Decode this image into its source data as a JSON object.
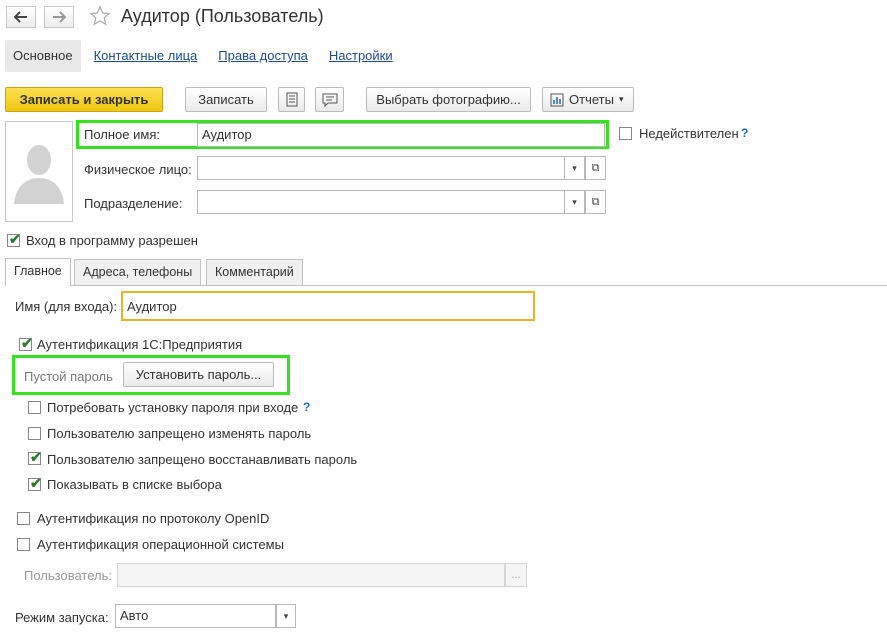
{
  "window": {
    "title": "Аудитор (Пользователь)"
  },
  "nav": {
    "tabs": [
      "Основное",
      "Контактные лица",
      "Права доступа",
      "Настройки"
    ]
  },
  "toolbar": {
    "save_close": "Записать и закрыть",
    "save": "Записать",
    "choose_photo": "Выбрать фотографию...",
    "reports": "Отчеты"
  },
  "form": {
    "full_name_label": "Полное имя:",
    "full_name_value": "Аудитор",
    "inactive_label": "Недействителен",
    "person_label": "Физическое лицо:",
    "person_value": "",
    "department_label": "Подразделение:",
    "department_value": "",
    "login_allowed_label": "Вход в программу разрешен"
  },
  "inner_tabs": [
    "Главное",
    "Адреса, телефоны",
    "Комментарий"
  ],
  "main_tab": {
    "login_name_label": "Имя (для входа):",
    "login_name_value": "Аудитор",
    "auth_1c_label": "Аутентификация 1С:Предприятия",
    "empty_password_label": "Пустой пароль",
    "set_password_button": "Установить пароль...",
    "options": [
      {
        "label": "Потребовать установку пароля при входе",
        "checked": false,
        "help": true
      },
      {
        "label": "Пользователю запрещено изменять пароль",
        "checked": false
      },
      {
        "label": "Пользователю запрещено восстанавливать пароль",
        "checked": true
      },
      {
        "label": "Показывать в списке выбора",
        "checked": true
      }
    ],
    "openid_label": "Аутентификация по протоколу OpenID",
    "os_auth_label": "Аутентификация операционной системы",
    "os_user_label": "Пользователь:",
    "os_user_value": "",
    "launch_mode_label": "Режим запуска:",
    "launch_mode_value": "Авто"
  },
  "icons": {
    "help": "?",
    "more": "...",
    "dropdown": "▾",
    "open": "⧉"
  },
  "colors": {
    "primary_button": "#f5d21e",
    "highlight_box": "#35e21f",
    "focus_border": "#e7b22c",
    "link": "#1a4b93"
  }
}
